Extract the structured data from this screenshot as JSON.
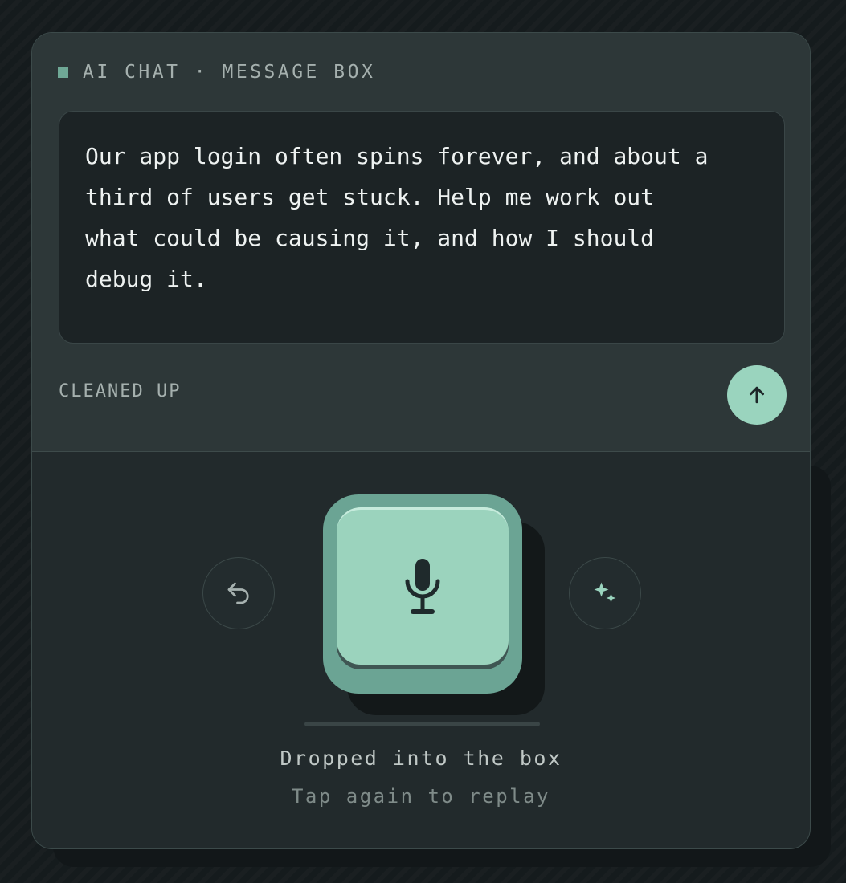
{
  "header": {
    "label": "AI CHAT · MESSAGE BOX"
  },
  "message": {
    "text": "Our app login often spins forever, and about a\nthird of users get stuck. Help me work out\nwhat could be causing it, and how I should\ndebug it."
  },
  "status": {
    "label": "CLEANED UP"
  },
  "controls": {
    "send_icon": "arrow-up-icon",
    "undo_icon": "undo-icon",
    "mic_icon": "microphone-icon",
    "sparkle_icon": "sparkle-icon"
  },
  "caption": {
    "primary": "Dropped into the box",
    "secondary": "Tap again to replay"
  },
  "colors": {
    "accent": "#9ad4be",
    "accent_dark": "#6ba494",
    "background": "#151b1d",
    "panel": "#2d3738"
  }
}
